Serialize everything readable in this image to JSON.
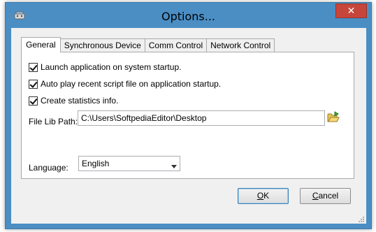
{
  "window": {
    "title": "Options...",
    "close_label": "✕"
  },
  "tabs": [
    {
      "label": "General",
      "active": true
    },
    {
      "label": "Synchronous Device",
      "active": false
    },
    {
      "label": "Comm Control",
      "active": false
    },
    {
      "label": "Network Control",
      "active": false
    }
  ],
  "general": {
    "options": [
      {
        "label": "Launch application on system startup.",
        "checked": true
      },
      {
        "label": "Auto play recent script file on application startup.",
        "checked": true
      },
      {
        "label": "Create statistics info.",
        "checked": true
      }
    ],
    "file_lib_path_label": "File Lib Path:",
    "file_lib_path_value": "C:\\Users\\SoftpediaEditor\\Desktop",
    "language_label": "Language:",
    "language_value": "English"
  },
  "buttons": {
    "ok_prefix": "",
    "ok_mnemonic": "O",
    "ok_rest": "K",
    "cancel_prefix": "",
    "cancel_mnemonic": "C",
    "cancel_rest": "ancel"
  },
  "icons": {
    "app": "app-icon",
    "browse": "folder-open-icon",
    "dropdown": "chevron-down-icon",
    "resize": "resize-grip-icon"
  }
}
